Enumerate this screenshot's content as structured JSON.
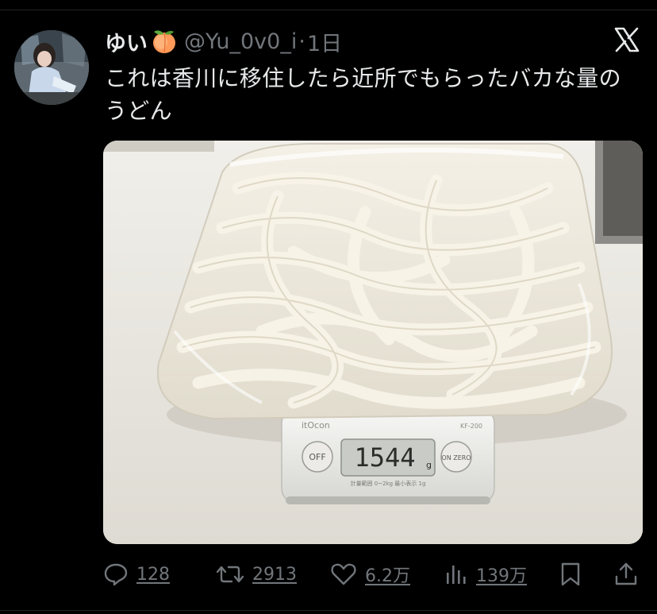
{
  "tweet": {
    "display_name": "ゆい",
    "handle": "@Yu_0v0_i",
    "separator": "·",
    "time": "1日",
    "text": "これは香川に移住したら近所でもらったバカな量のうどん",
    "emoji_icon": "peach-emoji-icon",
    "platform_icon": "x-logo-icon"
  },
  "media": {
    "scale_label": "itOcon",
    "scale_reading": "1544",
    "scale_unit": "g",
    "off_label": "OFF",
    "zero_label": "ON ZERO",
    "spec_text": "計量範囲 0~2kg  最小表示 1g",
    "model_text": "KF-200"
  },
  "actions": {
    "replies": "128",
    "retweets": "2913",
    "likes": "6.2万",
    "views": "139万"
  },
  "colors": {
    "background": "#000000",
    "primary_text": "#e7e9ea",
    "secondary_text": "#71767b"
  }
}
